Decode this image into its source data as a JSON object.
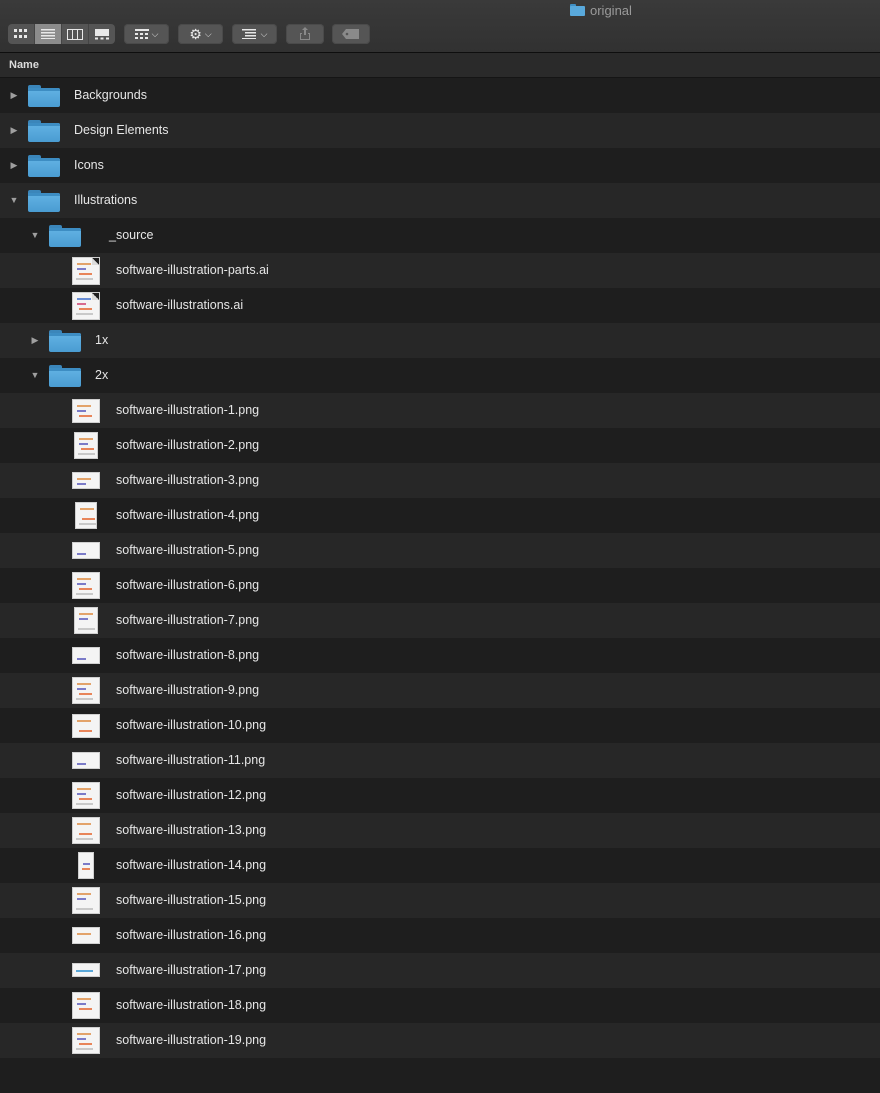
{
  "window": {
    "title": "original"
  },
  "toolbar": {
    "view_modes": [
      "icon-view",
      "list-view",
      "column-view",
      "gallery-view"
    ],
    "active_view": "list-view",
    "buttons": [
      "group-by",
      "action",
      "arrange",
      "share",
      "tags"
    ]
  },
  "header": {
    "name_column": "Name"
  },
  "rows": [
    {
      "label": "Backgrounds",
      "kind": "folder",
      "expanded": false
    },
    {
      "label": "Design Elements",
      "kind": "folder",
      "expanded": false
    },
    {
      "label": "Icons",
      "kind": "folder",
      "expanded": false
    },
    {
      "label": "Illustrations",
      "kind": "folder",
      "expanded": true
    },
    {
      "label": "_source",
      "kind": "folder",
      "expanded": true
    },
    {
      "label": "software-illustration-parts.ai",
      "kind": "ai-file"
    },
    {
      "label": "software-illustrations.ai",
      "kind": "ai-file"
    },
    {
      "label": "1x",
      "kind": "folder",
      "expanded": false
    },
    {
      "label": "2x",
      "kind": "folder",
      "expanded": true
    },
    {
      "label": "software-illustration-1.png",
      "kind": "png-file"
    },
    {
      "label": "software-illustration-2.png",
      "kind": "png-file"
    },
    {
      "label": "software-illustration-3.png",
      "kind": "png-file"
    },
    {
      "label": "software-illustration-4.png",
      "kind": "png-file"
    },
    {
      "label": "software-illustration-5.png",
      "kind": "png-file"
    },
    {
      "label": "software-illustration-6.png",
      "kind": "png-file"
    },
    {
      "label": "software-illustration-7.png",
      "kind": "png-file"
    },
    {
      "label": "software-illustration-8.png",
      "kind": "png-file"
    },
    {
      "label": "software-illustration-9.png",
      "kind": "png-file"
    },
    {
      "label": "software-illustration-10.png",
      "kind": "png-file"
    },
    {
      "label": "software-illustration-11.png",
      "kind": "png-file"
    },
    {
      "label": "software-illustration-12.png",
      "kind": "png-file"
    },
    {
      "label": "software-illustration-13.png",
      "kind": "png-file"
    },
    {
      "label": "software-illustration-14.png",
      "kind": "png-file"
    },
    {
      "label": "software-illustration-15.png",
      "kind": "png-file"
    },
    {
      "label": "software-illustration-16.png",
      "kind": "png-file"
    },
    {
      "label": "software-illustration-17.png",
      "kind": "png-file"
    },
    {
      "label": "software-illustration-18.png",
      "kind": "png-file"
    },
    {
      "label": "software-illustration-19.png",
      "kind": "png-file"
    }
  ]
}
